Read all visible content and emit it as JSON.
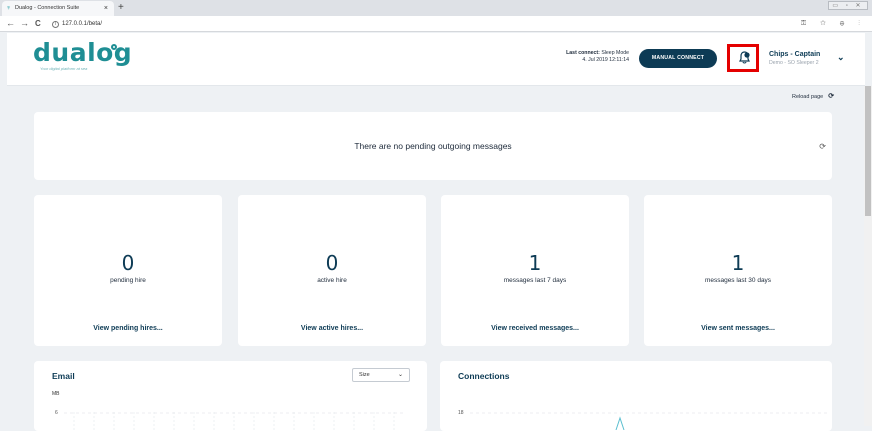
{
  "browser": {
    "tab_title": "Dualog - Connection Suite",
    "tab_close": "×",
    "new_tab": "+",
    "window_controls": "▭ ▫ ✕",
    "back": "←",
    "forward": "→",
    "reload": "C",
    "url": "127.0.0.1/beta/",
    "address_icons": "⚿ ☆ ⊕ ⋮"
  },
  "header": {
    "logo_text": "dualog",
    "tagline": "Your digital platform at sea",
    "last_connect_label": "Last connect:",
    "last_connect_mode": "Sleep Mode",
    "last_connect_time": "4. Jul 2019 12:11:14",
    "manual_connect_label": "MANUAL CONNECT",
    "notification_icon": "bell-icon",
    "user_name": "Chips - Captain",
    "user_sub": "Demo - SO Sleeper 2",
    "chevron": "⌄"
  },
  "reload_page_label": "Reload page",
  "pending_messages": {
    "text": "There are no pending outgoing messages",
    "refresh_icon": "⟳"
  },
  "stats": [
    {
      "value": "0",
      "label": "pending hire",
      "link": "View pending hires..."
    },
    {
      "value": "0",
      "label": "active hire",
      "link": "View active hires..."
    },
    {
      "value": "1",
      "label": "messages last 7 days",
      "link": "View received messages..."
    },
    {
      "value": "1",
      "label": "messages last 30 days",
      "link": "View sent messages..."
    }
  ],
  "email_chart": {
    "title": "Email",
    "size_select": "Size",
    "ylabel": "MB",
    "ytick_top": "6"
  },
  "connections_chart": {
    "title": "Connections",
    "ytick_top": "18"
  },
  "colors": {
    "brand": "#1f8e94",
    "navy": "#0d3b55",
    "highlight": "#e40000",
    "background": "#eef1f4"
  }
}
